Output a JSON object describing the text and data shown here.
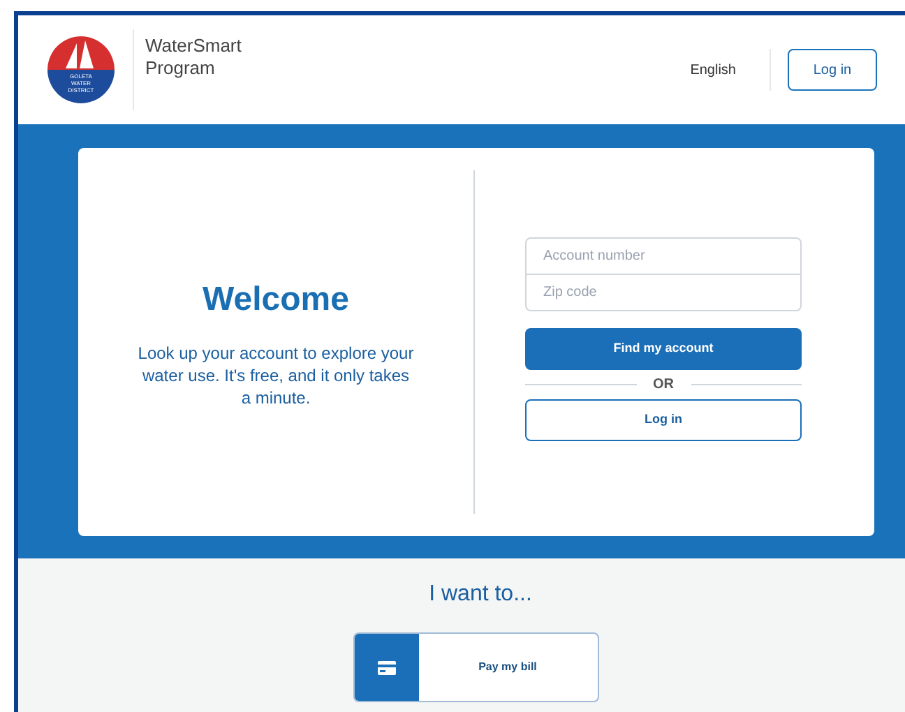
{
  "header": {
    "logo_text": [
      "GOLETA",
      "WATER",
      "DISTRICT"
    ],
    "program_name": "WaterSmart Program",
    "language": "English",
    "login_button": "Log in"
  },
  "welcome": {
    "title": "Welcome",
    "text": "Look up your account to explore your water use. It's free, and it only takes a minute."
  },
  "lookup_form": {
    "account_placeholder": "Account number",
    "zip_placeholder": "Zip code",
    "submit_button": "Find my account",
    "divider": "OR",
    "login_button": "Log in"
  },
  "actions": {
    "title": "I want to...",
    "items": [
      {
        "label": "Pay my bill"
      }
    ]
  }
}
